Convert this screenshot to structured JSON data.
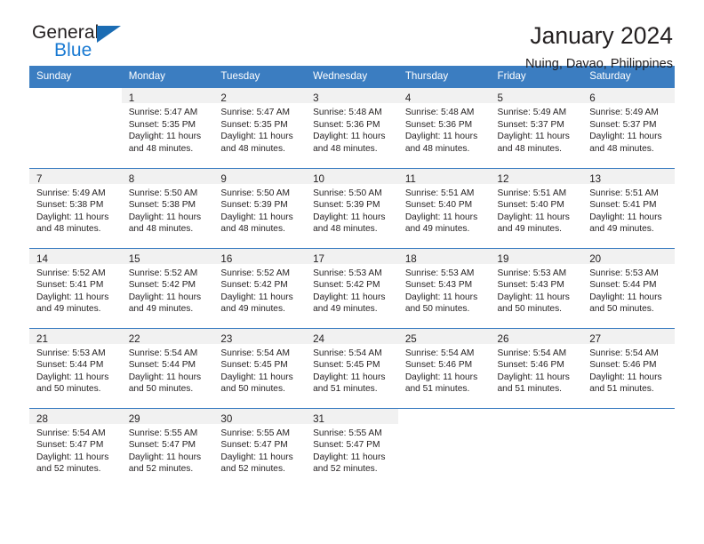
{
  "brand": {
    "name_top": "General",
    "name_bottom": "Blue",
    "triangle_color": "#1b6cb3",
    "blue_text_color": "#1879d2"
  },
  "header": {
    "title": "January 2024",
    "subtitle": "Nuing, Davao, Philippines"
  },
  "theme": {
    "header_row_bg": "#3b7dc1",
    "header_row_text": "#ffffff",
    "daynum_band_bg": "#f1f1f1",
    "week_separator": "#3b7dc1",
    "body_text": "#231f20"
  },
  "weekday_headers": [
    "Sunday",
    "Monday",
    "Tuesday",
    "Wednesday",
    "Thursday",
    "Friday",
    "Saturday"
  ],
  "weeks": [
    [
      {
        "day": "",
        "sunrise": "",
        "sunset": "",
        "daylight": "",
        "daylight2": ""
      },
      {
        "day": "1",
        "sunrise": "Sunrise: 5:47 AM",
        "sunset": "Sunset: 5:35 PM",
        "daylight": "Daylight: 11 hours",
        "daylight2": "and 48 minutes."
      },
      {
        "day": "2",
        "sunrise": "Sunrise: 5:47 AM",
        "sunset": "Sunset: 5:35 PM",
        "daylight": "Daylight: 11 hours",
        "daylight2": "and 48 minutes."
      },
      {
        "day": "3",
        "sunrise": "Sunrise: 5:48 AM",
        "sunset": "Sunset: 5:36 PM",
        "daylight": "Daylight: 11 hours",
        "daylight2": "and 48 minutes."
      },
      {
        "day": "4",
        "sunrise": "Sunrise: 5:48 AM",
        "sunset": "Sunset: 5:36 PM",
        "daylight": "Daylight: 11 hours",
        "daylight2": "and 48 minutes."
      },
      {
        "day": "5",
        "sunrise": "Sunrise: 5:49 AM",
        "sunset": "Sunset: 5:37 PM",
        "daylight": "Daylight: 11 hours",
        "daylight2": "and 48 minutes."
      },
      {
        "day": "6",
        "sunrise": "Sunrise: 5:49 AM",
        "sunset": "Sunset: 5:37 PM",
        "daylight": "Daylight: 11 hours",
        "daylight2": "and 48 minutes."
      }
    ],
    [
      {
        "day": "7",
        "sunrise": "Sunrise: 5:49 AM",
        "sunset": "Sunset: 5:38 PM",
        "daylight": "Daylight: 11 hours",
        "daylight2": "and 48 minutes."
      },
      {
        "day": "8",
        "sunrise": "Sunrise: 5:50 AM",
        "sunset": "Sunset: 5:38 PM",
        "daylight": "Daylight: 11 hours",
        "daylight2": "and 48 minutes."
      },
      {
        "day": "9",
        "sunrise": "Sunrise: 5:50 AM",
        "sunset": "Sunset: 5:39 PM",
        "daylight": "Daylight: 11 hours",
        "daylight2": "and 48 minutes."
      },
      {
        "day": "10",
        "sunrise": "Sunrise: 5:50 AM",
        "sunset": "Sunset: 5:39 PM",
        "daylight": "Daylight: 11 hours",
        "daylight2": "and 48 minutes."
      },
      {
        "day": "11",
        "sunrise": "Sunrise: 5:51 AM",
        "sunset": "Sunset: 5:40 PM",
        "daylight": "Daylight: 11 hours",
        "daylight2": "and 49 minutes."
      },
      {
        "day": "12",
        "sunrise": "Sunrise: 5:51 AM",
        "sunset": "Sunset: 5:40 PM",
        "daylight": "Daylight: 11 hours",
        "daylight2": "and 49 minutes."
      },
      {
        "day": "13",
        "sunrise": "Sunrise: 5:51 AM",
        "sunset": "Sunset: 5:41 PM",
        "daylight": "Daylight: 11 hours",
        "daylight2": "and 49 minutes."
      }
    ],
    [
      {
        "day": "14",
        "sunrise": "Sunrise: 5:52 AM",
        "sunset": "Sunset: 5:41 PM",
        "daylight": "Daylight: 11 hours",
        "daylight2": "and 49 minutes."
      },
      {
        "day": "15",
        "sunrise": "Sunrise: 5:52 AM",
        "sunset": "Sunset: 5:42 PM",
        "daylight": "Daylight: 11 hours",
        "daylight2": "and 49 minutes."
      },
      {
        "day": "16",
        "sunrise": "Sunrise: 5:52 AM",
        "sunset": "Sunset: 5:42 PM",
        "daylight": "Daylight: 11 hours",
        "daylight2": "and 49 minutes."
      },
      {
        "day": "17",
        "sunrise": "Sunrise: 5:53 AM",
        "sunset": "Sunset: 5:42 PM",
        "daylight": "Daylight: 11 hours",
        "daylight2": "and 49 minutes."
      },
      {
        "day": "18",
        "sunrise": "Sunrise: 5:53 AM",
        "sunset": "Sunset: 5:43 PM",
        "daylight": "Daylight: 11 hours",
        "daylight2": "and 50 minutes."
      },
      {
        "day": "19",
        "sunrise": "Sunrise: 5:53 AM",
        "sunset": "Sunset: 5:43 PM",
        "daylight": "Daylight: 11 hours",
        "daylight2": "and 50 minutes."
      },
      {
        "day": "20",
        "sunrise": "Sunrise: 5:53 AM",
        "sunset": "Sunset: 5:44 PM",
        "daylight": "Daylight: 11 hours",
        "daylight2": "and 50 minutes."
      }
    ],
    [
      {
        "day": "21",
        "sunrise": "Sunrise: 5:53 AM",
        "sunset": "Sunset: 5:44 PM",
        "daylight": "Daylight: 11 hours",
        "daylight2": "and 50 minutes."
      },
      {
        "day": "22",
        "sunrise": "Sunrise: 5:54 AM",
        "sunset": "Sunset: 5:44 PM",
        "daylight": "Daylight: 11 hours",
        "daylight2": "and 50 minutes."
      },
      {
        "day": "23",
        "sunrise": "Sunrise: 5:54 AM",
        "sunset": "Sunset: 5:45 PM",
        "daylight": "Daylight: 11 hours",
        "daylight2": "and 50 minutes."
      },
      {
        "day": "24",
        "sunrise": "Sunrise: 5:54 AM",
        "sunset": "Sunset: 5:45 PM",
        "daylight": "Daylight: 11 hours",
        "daylight2": "and 51 minutes."
      },
      {
        "day": "25",
        "sunrise": "Sunrise: 5:54 AM",
        "sunset": "Sunset: 5:46 PM",
        "daylight": "Daylight: 11 hours",
        "daylight2": "and 51 minutes."
      },
      {
        "day": "26",
        "sunrise": "Sunrise: 5:54 AM",
        "sunset": "Sunset: 5:46 PM",
        "daylight": "Daylight: 11 hours",
        "daylight2": "and 51 minutes."
      },
      {
        "day": "27",
        "sunrise": "Sunrise: 5:54 AM",
        "sunset": "Sunset: 5:46 PM",
        "daylight": "Daylight: 11 hours",
        "daylight2": "and 51 minutes."
      }
    ],
    [
      {
        "day": "28",
        "sunrise": "Sunrise: 5:54 AM",
        "sunset": "Sunset: 5:47 PM",
        "daylight": "Daylight: 11 hours",
        "daylight2": "and 52 minutes."
      },
      {
        "day": "29",
        "sunrise": "Sunrise: 5:55 AM",
        "sunset": "Sunset: 5:47 PM",
        "daylight": "Daylight: 11 hours",
        "daylight2": "and 52 minutes."
      },
      {
        "day": "30",
        "sunrise": "Sunrise: 5:55 AM",
        "sunset": "Sunset: 5:47 PM",
        "daylight": "Daylight: 11 hours",
        "daylight2": "and 52 minutes."
      },
      {
        "day": "31",
        "sunrise": "Sunrise: 5:55 AM",
        "sunset": "Sunset: 5:47 PM",
        "daylight": "Daylight: 11 hours",
        "daylight2": "and 52 minutes."
      },
      {
        "day": "",
        "sunrise": "",
        "sunset": "",
        "daylight": "",
        "daylight2": ""
      },
      {
        "day": "",
        "sunrise": "",
        "sunset": "",
        "daylight": "",
        "daylight2": ""
      },
      {
        "day": "",
        "sunrise": "",
        "sunset": "",
        "daylight": "",
        "daylight2": ""
      }
    ]
  ]
}
